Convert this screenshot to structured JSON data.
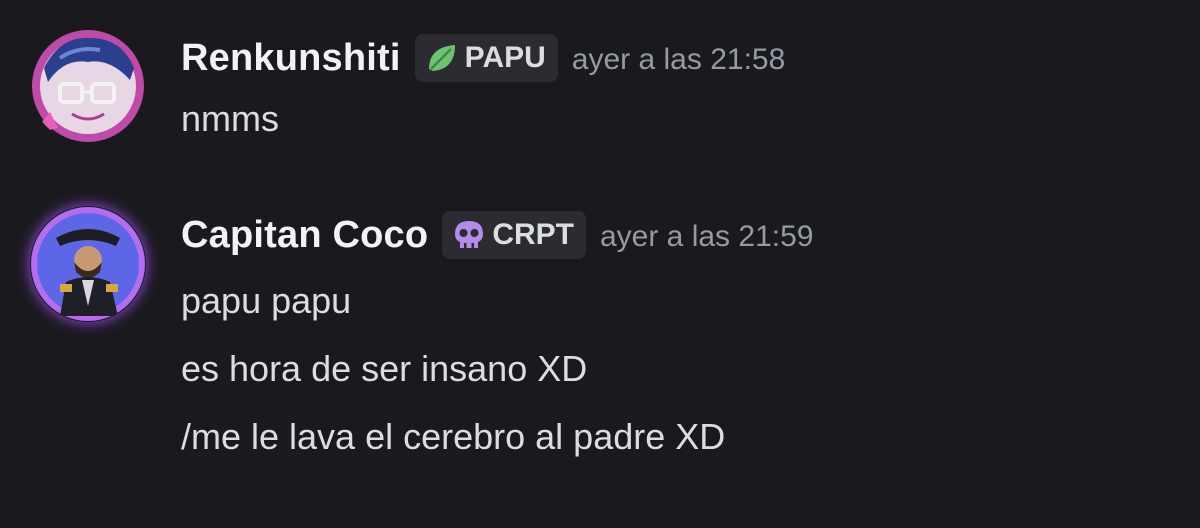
{
  "messages": [
    {
      "username": "Renkunshiti",
      "tag_icon": "leaf-icon",
      "tag_label": "PAPU",
      "tag_icon_color": "#5fbf6a",
      "timestamp": "ayer a las 21:58",
      "lines": [
        "nmms"
      ]
    },
    {
      "username": "Capitan Coco",
      "tag_icon": "skull-icon",
      "tag_label": "CRPT",
      "tag_icon_color": "#b38be8",
      "timestamp": "ayer a las 21:59",
      "lines": [
        "papu papu",
        "es hora de ser insano XD",
        "/me le lava el cerebro al padre XD"
      ]
    }
  ]
}
